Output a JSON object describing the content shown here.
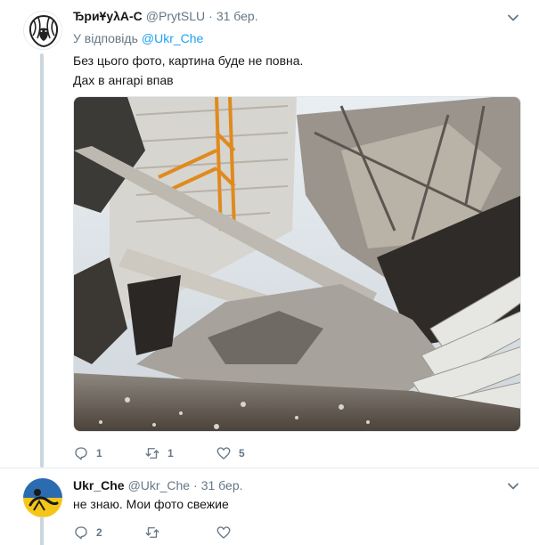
{
  "tweet1": {
    "display_name": "ЂриҰуλА-С",
    "screen_name": "@PrytSLU",
    "separator": "·",
    "date": "31 бер.",
    "reply_prefix": "У відповідь",
    "reply_handle": "@Ukr_Che",
    "text_line1": "Без цього фото, картина буде не повна.",
    "text_line2": "Дах в ангарі впав",
    "reply_count": "1",
    "retweet_count": "1",
    "like_count": "5"
  },
  "tweet2": {
    "display_name": "Ukr_Che",
    "screen_name": "@Ukr_Che",
    "separator": "·",
    "date": "31 бер.",
    "text": "не знаю. Мои фото свежие",
    "reply_count": "2",
    "retweet_count": "",
    "like_count": ""
  },
  "colors": {
    "accent": "#1da1f2",
    "muted": "#657786",
    "text": "#14171a",
    "thread_line": "#ccd6dd"
  },
  "icons": [
    "chevron-down-icon",
    "reply-icon",
    "retweet-icon",
    "like-icon",
    "lion-avatar",
    "flag-avatar"
  ]
}
